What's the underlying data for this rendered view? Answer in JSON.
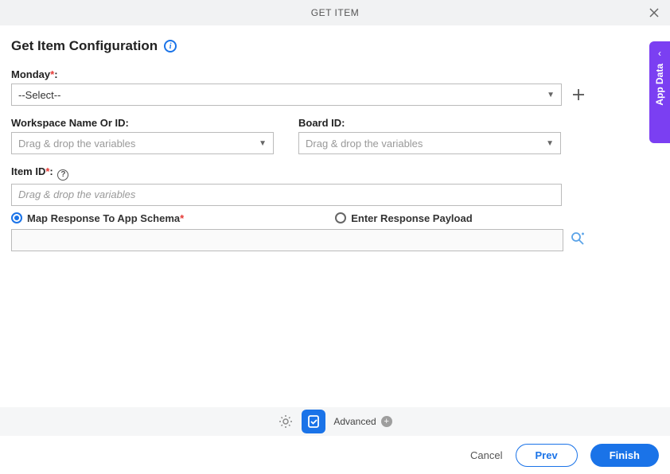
{
  "titlebar": {
    "title": "GET ITEM"
  },
  "page": {
    "title": "Get Item Configuration"
  },
  "fields": {
    "monday": {
      "label": "Monday",
      "required": "*",
      "value": "--Select--"
    },
    "workspace": {
      "label": "Workspace Name Or ID:",
      "placeholder": "Drag & drop the variables"
    },
    "board": {
      "label": "Board ID:",
      "placeholder": "Drag & drop the variables"
    },
    "item": {
      "label": "Item ID",
      "required": "*",
      "placeholder": "Drag & drop the variables"
    }
  },
  "radios": {
    "map": {
      "label": "Map Response To App Schema",
      "required": "*",
      "selected": true
    },
    "payload": {
      "label": "Enter Response Payload",
      "selected": false
    }
  },
  "sidetab": {
    "label": "App Data"
  },
  "toolbar": {
    "advanced": "Advanced"
  },
  "footer": {
    "cancel": "Cancel",
    "prev": "Prev",
    "finish": "Finish"
  }
}
